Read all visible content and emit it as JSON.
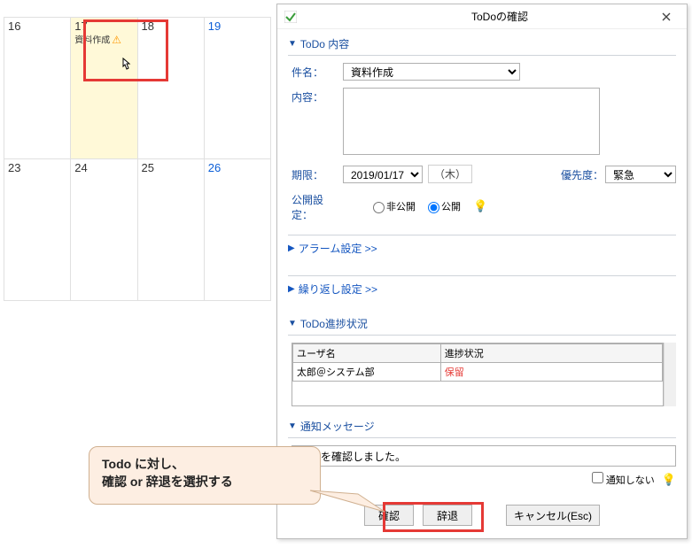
{
  "calendar": {
    "rows": [
      {
        "cells": [
          {
            "day": "16"
          },
          {
            "day": "17",
            "highlight": true,
            "event": "資料作成",
            "warning": true
          },
          {
            "day": "18"
          },
          {
            "day": "19",
            "blue": true
          }
        ]
      },
      {
        "cells": [
          {
            "day": "23"
          },
          {
            "day": "24"
          },
          {
            "day": "25"
          },
          {
            "day": "26",
            "blue": true
          }
        ]
      }
    ]
  },
  "dialog": {
    "title": "ToDoの確認",
    "section_content": {
      "header": "ToDo 内容",
      "subject_label": "件名：",
      "subject_value": "資料作成",
      "content_label": "内容：",
      "deadline_label": "期限：",
      "deadline_value": "2019/01/17",
      "dow": "（木）",
      "priority_label": "優先度：",
      "priority_value": "緊急",
      "visibility_label": "公開設定：",
      "vis_private": "非公開",
      "vis_public": "公開"
    },
    "alarm_link": "アラーム設定 >>",
    "repeat_link": "繰り返し設定 >>",
    "progress": {
      "header": "ToDo進捗状況",
      "col_user": "ユーザ名",
      "col_status": "進捗状況",
      "user": "太郎＠システム部",
      "status": "保留"
    },
    "notify": {
      "header": "通知メッセージ",
      "text": "ToDoを確認しました。",
      "cb_label": "通知しない"
    },
    "buttons": {
      "confirm": "確認",
      "decline": "辞退",
      "cancel": "キャンセル(Esc)"
    }
  },
  "callout": {
    "line1": "Todo に対し、",
    "line2": "確認 or 辞退を選択する"
  }
}
